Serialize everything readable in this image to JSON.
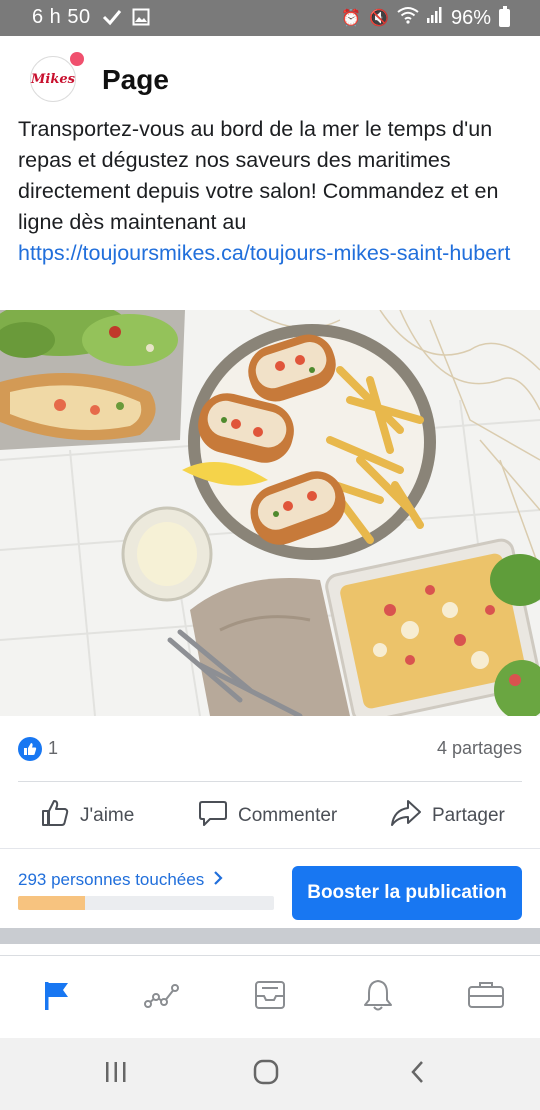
{
  "status_bar": {
    "time": "6 h 50",
    "battery": "96%",
    "icons": [
      "check-icon",
      "image-icon",
      "alarm-icon",
      "mute-icon",
      "wifi-icon",
      "signal-icon",
      "battery-icon"
    ]
  },
  "header": {
    "logo_text": "Mikes",
    "title": "Page"
  },
  "post": {
    "text": "Transportez-vous au bord de la mer le temps d'un repas et dégustez nos saveurs des maritimes directement depuis votre salon! Commandez et en ligne dès maintenant au",
    "link": "https://toujoursmikes.ca/toujours-mikes-saint-hubert"
  },
  "reactions": {
    "count": "1",
    "shares": "4 partages"
  },
  "actions": {
    "like": "J'aime",
    "comment": "Commenter",
    "share": "Partager"
  },
  "insights": {
    "reach": "293 personnes touchées",
    "reach_fraction": 0.26,
    "boost": "Booster la publication"
  },
  "bottom_nav": [
    "flag-icon",
    "insights-icon",
    "inbox-icon",
    "bell-icon",
    "briefcase-icon"
  ],
  "colors": {
    "accent": "#1877f2",
    "link": "#216fdb",
    "reach_fill": "#f7c37f"
  }
}
